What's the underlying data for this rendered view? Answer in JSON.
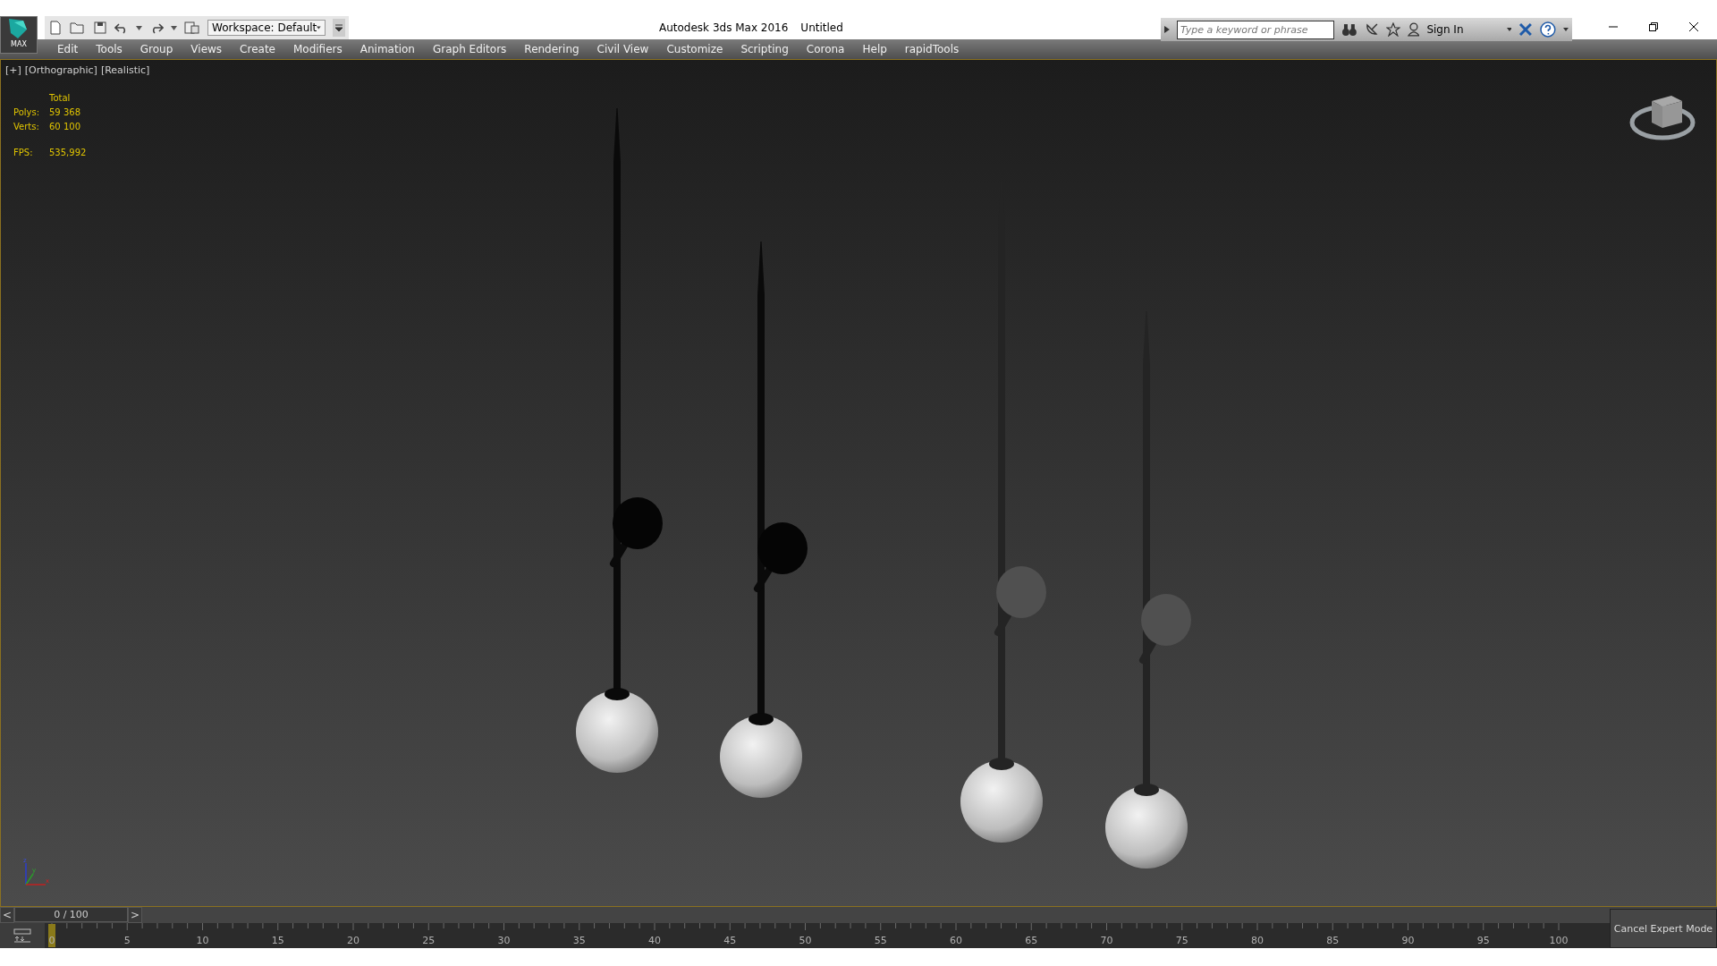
{
  "title_bar": {
    "app_title": "Autodesk 3ds Max 2016",
    "document": "Untitled",
    "logo_label": "MAX",
    "workspace": "Workspace: Default",
    "search": {
      "placeholder": "Type a keyword or phrase"
    },
    "sign_in": "Sign In"
  },
  "menu": [
    "Edit",
    "Tools",
    "Group",
    "Views",
    "Create",
    "Modifiers",
    "Animation",
    "Graph Editors",
    "Rendering",
    "Civil View",
    "Customize",
    "Scripting",
    "Corona",
    "Help",
    "rapidTools"
  ],
  "viewport": {
    "labels": [
      "[+]",
      "[Orthographic]",
      "[Realistic]"
    ],
    "stats": {
      "header": "Total",
      "rows": [
        {
          "label": "Polys:",
          "value": "59 368"
        },
        {
          "label": "Verts:",
          "value": "60 100"
        }
      ],
      "fps_label": "FPS:",
      "fps_value": "535,992"
    },
    "axes": {
      "z": "z",
      "y": "y",
      "x": "x"
    }
  },
  "time_slider": {
    "prev": "<",
    "next": ">",
    "reading": "0 / 100",
    "level": 0
  },
  "track_bar": {
    "labels": [
      "0",
      "5",
      "10",
      "15",
      "20",
      "25",
      "30",
      "35",
      "40",
      "45",
      "50",
      "55",
      "60",
      "65",
      "70",
      "75",
      "80",
      "85",
      "90",
      "95",
      "100"
    ]
  },
  "expert_button": "Cancel Expert Mode"
}
